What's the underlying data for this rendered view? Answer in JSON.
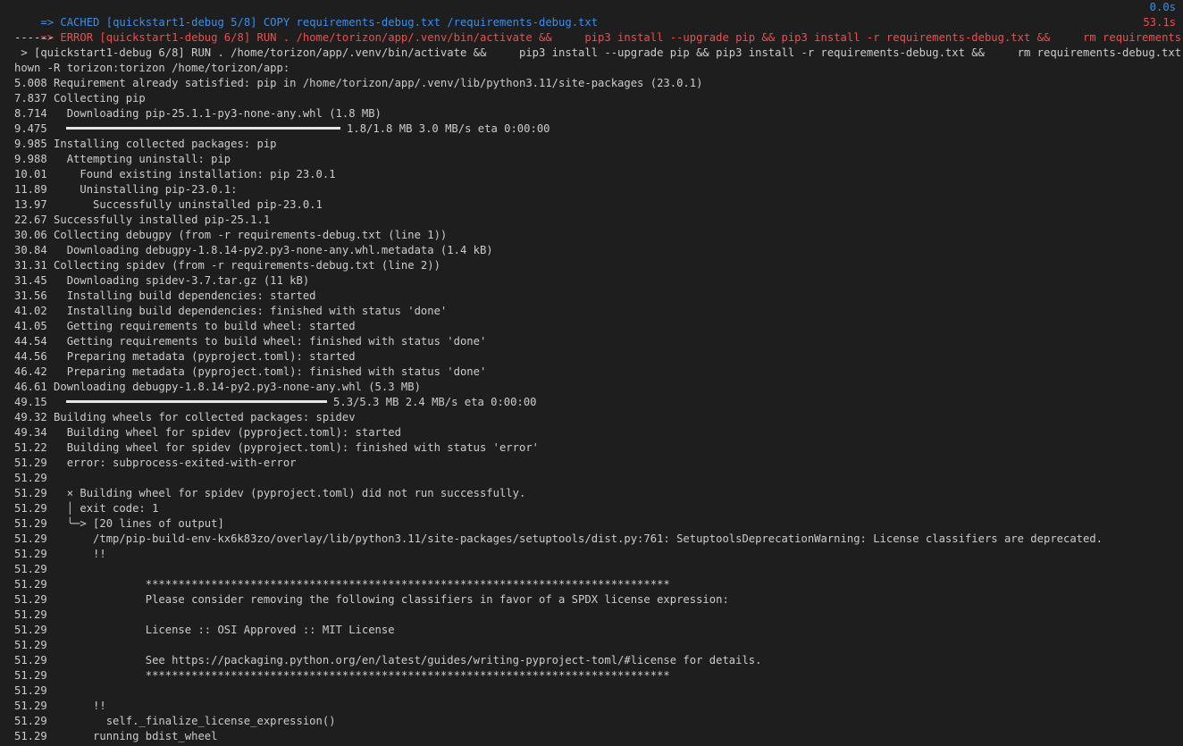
{
  "header": {
    "cached_text": "=> CACHED [quickstart1-debug 5/8] COPY requirements-debug.txt /requirements-debug.txt",
    "cached_time": "0.0s",
    "error_text": "=> ERROR [quickstart1-debug 6/8] RUN . /home/torizon/app/.venv/bin/activate &&     pip3 install --upgrade pip && pip3 install -r requirements-debug.txt &&     rm requirements-deb",
    "error_time": "53.1s",
    "separator": "------"
  },
  "lines": [
    " > [quickstart1-debug 6/8] RUN . /home/torizon/app/.venv/bin/activate &&     pip3 install --upgrade pip && pip3 install -r requirements-debug.txt &&     rm requirements-debug.txt &&     c",
    "hown -R torizon:torizon /home/torizon/app:",
    "5.008 Requirement already satisfied: pip in /home/torizon/app/.venv/lib/python3.11/site-packages (23.0.1)",
    "7.837 Collecting pip",
    "8.714   Downloading pip-25.1.1-py3-none-any.whl (1.8 MB)",
    "9.475 ",
    "9.985 Installing collected packages: pip",
    "9.988   Attempting uninstall: pip",
    "10.01     Found existing installation: pip 23.0.1",
    "11.89     Uninstalling pip-23.0.1:",
    "13.97       Successfully uninstalled pip-23.0.1",
    "22.67 Successfully installed pip-25.1.1",
    "30.06 Collecting debugpy (from -r requirements-debug.txt (line 1))",
    "30.84   Downloading debugpy-1.8.14-py2.py3-none-any.whl.metadata (1.4 kB)",
    "31.31 Collecting spidev (from -r requirements-debug.txt (line 2))",
    "31.45   Downloading spidev-3.7.tar.gz (11 kB)",
    "31.56   Installing build dependencies: started",
    "41.02   Installing build dependencies: finished with status 'done'",
    "41.05   Getting requirements to build wheel: started",
    "44.54   Getting requirements to build wheel: finished with status 'done'",
    "44.56   Preparing metadata (pyproject.toml): started",
    "46.42   Preparing metadata (pyproject.toml): finished with status 'done'",
    "46.61 Downloading debugpy-1.8.14-py2.py3-none-any.whl (5.3 MB)",
    "49.15 ",
    "49.32 Building wheels for collected packages: spidev",
    "49.34   Building wheel for spidev (pyproject.toml): started",
    "51.22   Building wheel for spidev (pyproject.toml): finished with status 'error'",
    "51.29   error: subprocess-exited-with-error",
    "51.29",
    "51.29   × Building wheel for spidev (pyproject.toml) did not run successfully.",
    "51.29   │ exit code: 1",
    "51.29   ╰─> [20 lines of output]",
    "51.29       /tmp/pip-build-env-kx6k83zo/overlay/lib/python3.11/site-packages/setuptools/dist.py:761: SetuptoolsDeprecationWarning: License classifiers are deprecated.",
    "51.29       !!",
    "51.29",
    "51.29               ********************************************************************************",
    "51.29               Please consider removing the following classifiers in favor of a SPDX license expression:",
    "51.29",
    "51.29               License :: OSI Approved :: MIT License",
    "51.29",
    "51.29               See https://packaging.python.org/en/latest/guides/writing-pyproject-toml/#license for details.",
    "51.29               ********************************************************************************",
    "51.29",
    "51.29       !!",
    "51.29         self._finalize_license_expression()",
    "51.29       running bdist_wheel"
  ],
  "progress": [
    {
      "line_index": 5,
      "label": "1.8/1.8 MB 3.0 MB/s eta 0:00:00",
      "fraction": 1.0
    },
    {
      "line_index": 23,
      "label": "5.3/5.3 MB 2.4 MB/s eta 0:00:00",
      "fraction": 1.0
    }
  ],
  "colors": {
    "background": "#1e1e1e",
    "text": "#cccccc",
    "cached": "#3b8eea",
    "error": "#f14c4c"
  }
}
